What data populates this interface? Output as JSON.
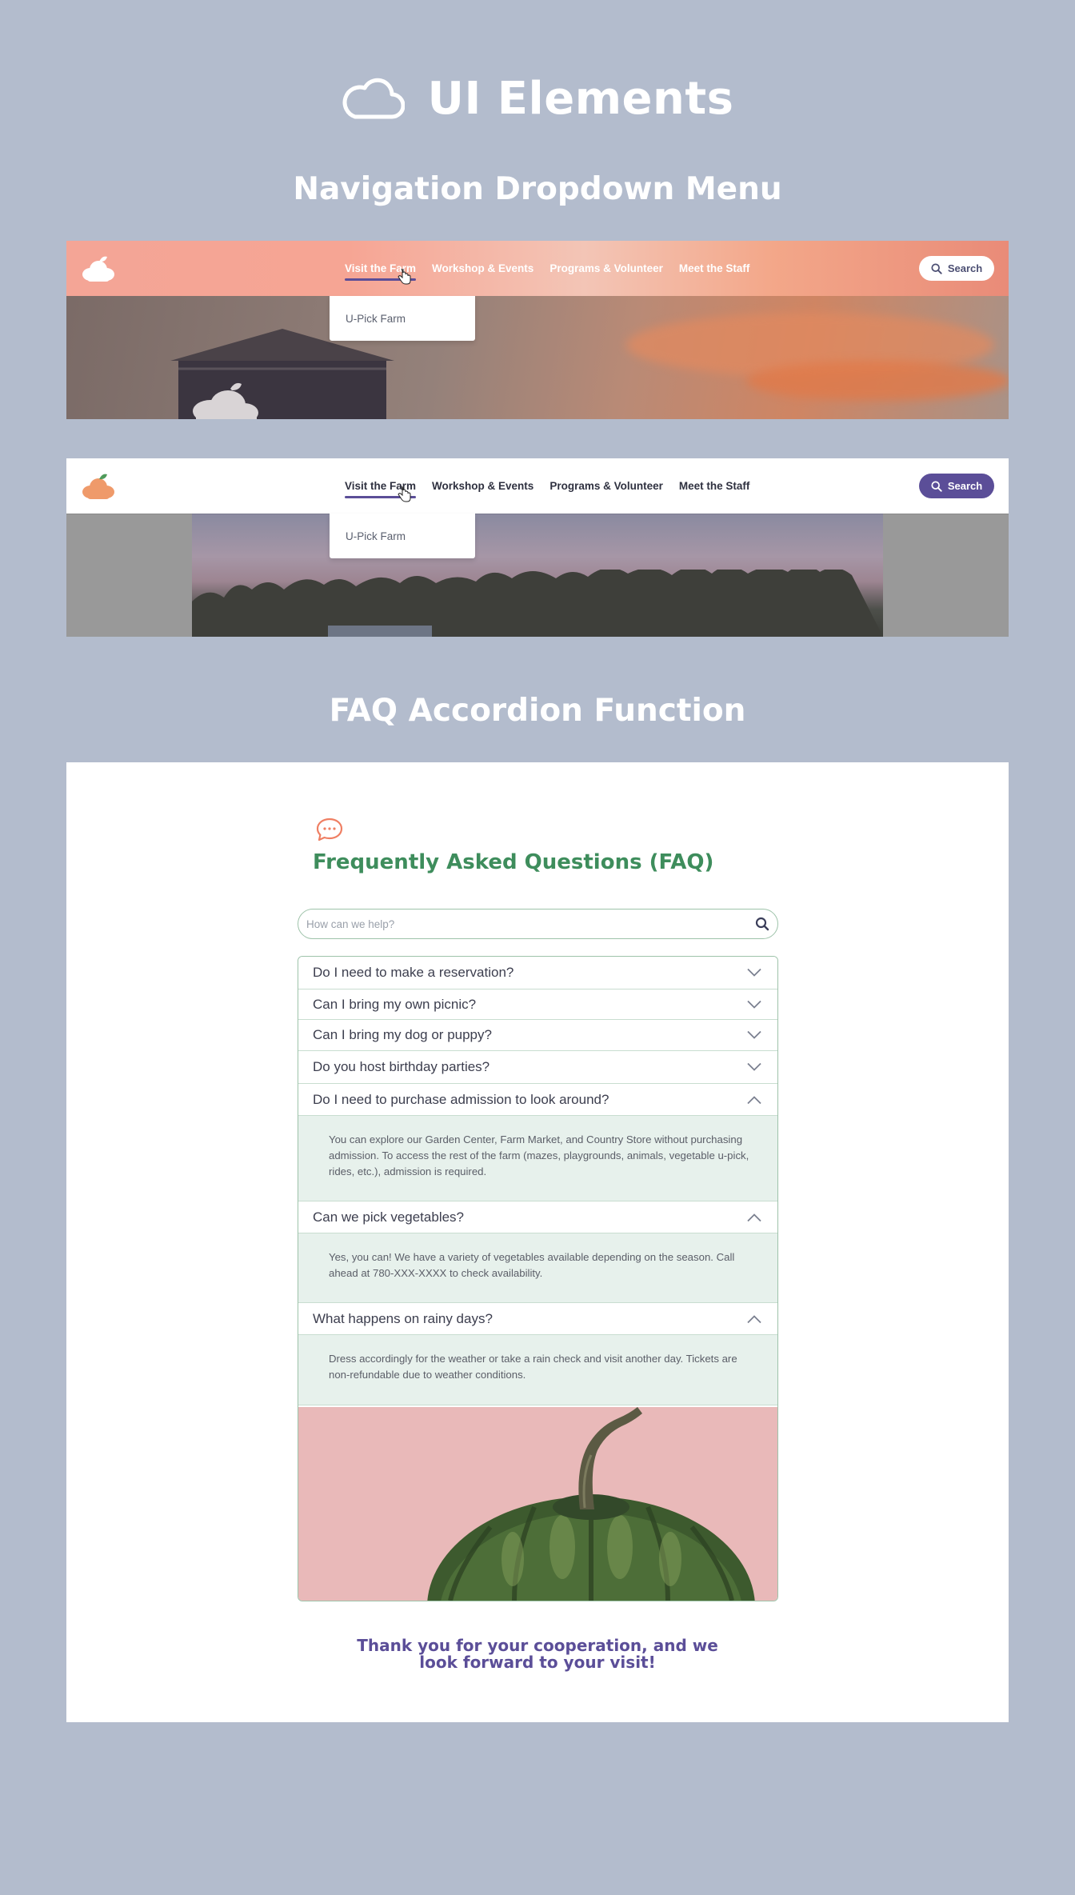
{
  "page": {
    "title": "UI Elements",
    "nav_section_heading": "Navigation Dropdown Menu",
    "faq_section_heading": "FAQ Accordion Function"
  },
  "nav_demo_transparent": {
    "links": [
      "Visit the Farm",
      "Workshop & Events",
      "Programs & Volunteer",
      "Meet the Staff"
    ],
    "active_link": "Visit the Farm",
    "search_label": "Search",
    "dropdown_items": [
      "U-Pick Farm"
    ]
  },
  "nav_demo_white": {
    "links": [
      "Visit the Farm",
      "Workshop & Events",
      "Programs & Volunteer",
      "Meet the Staff"
    ],
    "active_link": "Visit the Farm",
    "search_label": "Search",
    "dropdown_items": [
      "U-Pick Farm"
    ]
  },
  "faq": {
    "title": "Frequently Asked Questions (FAQ)",
    "search_placeholder": "How can we help?",
    "items": [
      {
        "question": "Do I need to make a reservation?",
        "expanded": false
      },
      {
        "question": "Can I bring my own picnic?",
        "expanded": false
      },
      {
        "question": "Can I bring my dog or puppy?",
        "expanded": false
      },
      {
        "question": "Do you host birthday parties?",
        "expanded": false
      },
      {
        "question": "Do I need to purchase admission to look around?",
        "expanded": true,
        "answer": "You can explore our Garden Center, Farm Market, and Country Store without purchasing admission. To access the rest of the farm (mazes, playgrounds, animals, vegetable u-pick, rides, etc.), admission is required."
      },
      {
        "question": "Can we pick vegetables?",
        "expanded": true,
        "answer": "Yes, you can! We have a variety of vegetables available depending on the season. Call ahead at 780-XXX-XXXX to check availability."
      },
      {
        "question": "What happens on rainy days?",
        "expanded": true,
        "answer": "Dress accordingly for the weather or take a rain check and visit another day. Tickets are non-refundable due to weather conditions."
      }
    ],
    "closing_line1": "Thank you for your cooperation, and we",
    "closing_line2": "look forward to your visit!"
  },
  "colors": {
    "page_bg": "#b3bccd",
    "brand_purple": "#5b4e98",
    "faq_green": "#3e8d5c",
    "answer_bg": "#e7f1ec",
    "accent_coral": "#ef7f63"
  }
}
